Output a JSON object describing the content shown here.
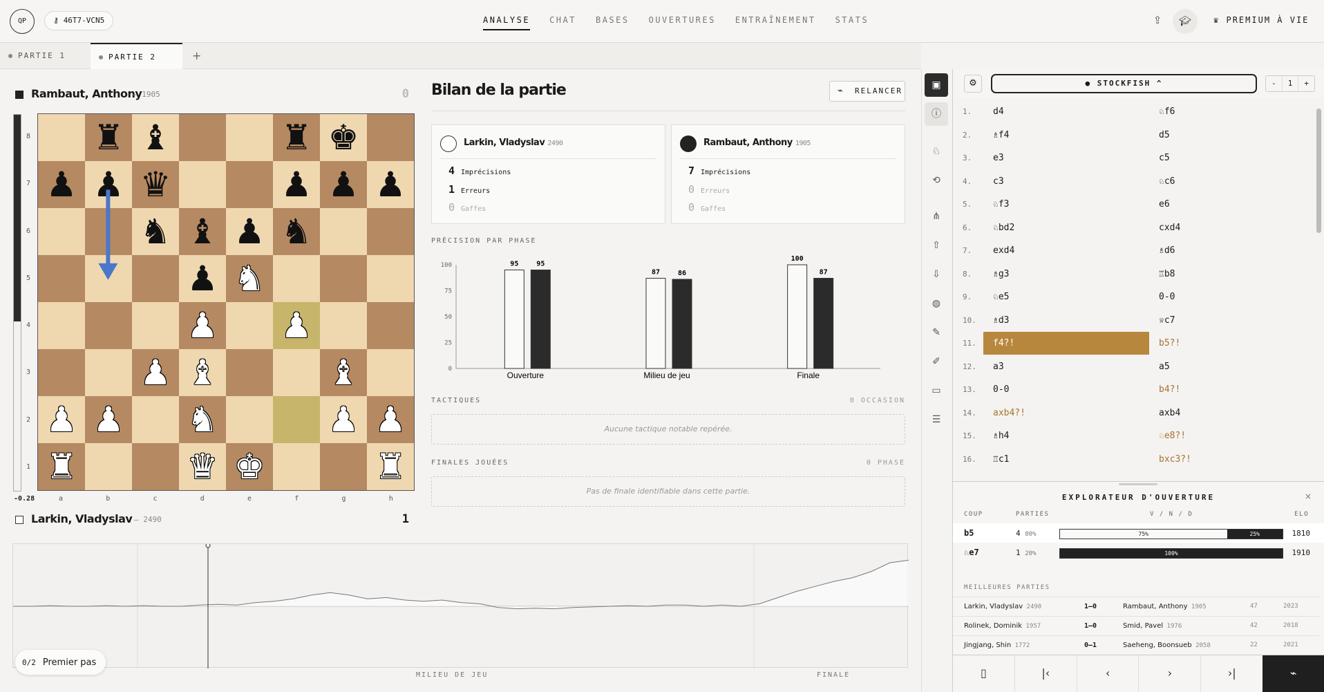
{
  "header": {
    "logo": "QP",
    "game_code": "46T7-VCN5",
    "nav": [
      "ANALYSE",
      "CHAT",
      "BASES",
      "OUVERTURES",
      "ENTRAÎNEMENT",
      "STATS"
    ],
    "active_nav": "ANALYSE",
    "premium": "PREMIUM À VIE",
    "icons": [
      "upload-icon",
      "graduation-cap-icon",
      "crown-icon"
    ]
  },
  "tabs": {
    "items": [
      "PARTIE 1",
      "PARTIE 2"
    ],
    "active": "PARTIE 2",
    "add": "+"
  },
  "top_player": {
    "name": "Rambaut, Anthony",
    "rating": "– 1905",
    "score": "0",
    "color": "black"
  },
  "bottom_player": {
    "name": "Larkin, Vladyslav",
    "rating": "– 2490",
    "score": "1",
    "color": "white"
  },
  "eval": {
    "text": "-0.28",
    "white_fraction": 0.45
  },
  "board": {
    "ranks": [
      "8",
      "7",
      "6",
      "5",
      "4",
      "3",
      "2",
      "1"
    ],
    "files": [
      "a",
      "b",
      "c",
      "d",
      "e",
      "f",
      "g",
      "h"
    ],
    "position": [
      [
        "",
        "r",
        "b",
        "",
        "",
        "r",
        "k",
        ""
      ],
      [
        "p",
        "p",
        "q",
        "",
        "",
        "p",
        "p",
        "p"
      ],
      [
        "",
        "",
        "n",
        "b",
        "p",
        "n",
        "",
        ""
      ],
      [
        "",
        "",
        "",
        "p",
        "N",
        "",
        "",
        ""
      ],
      [
        "",
        "",
        "",
        "P",
        "",
        "P",
        "",
        ""
      ],
      [
        "",
        "",
        "P",
        "B",
        "",
        "",
        "B",
        ""
      ],
      [
        "P",
        "P",
        "",
        "N",
        "",
        "",
        "P",
        "P"
      ],
      [
        "R",
        "",
        "",
        "Q",
        "K",
        "",
        "",
        "R"
      ]
    ],
    "last_move": [
      "f2",
      "f4"
    ],
    "arrow": {
      "from": "b7",
      "to": "b5",
      "color": "#4a77c9"
    }
  },
  "eval_graph": {
    "phase_labels": [
      "MILIEU DE JEU",
      "FINALE"
    ],
    "values": [
      0.0,
      0.0,
      0.05,
      0.0,
      0.0,
      0.05,
      0.0,
      0.05,
      0.0,
      0.0,
      0.1,
      0.15,
      0.1,
      0.3,
      0.4,
      0.6,
      0.9,
      1.1,
      0.9,
      0.6,
      0.7,
      0.5,
      0.4,
      0.5,
      0.3,
      0.2,
      -0.1,
      -0.2,
      -0.15,
      -0.2,
      -0.1,
      -0.05,
      0.0,
      0.05,
      0.0,
      0.1,
      0.1,
      0.0,
      0.1,
      0.0,
      0.2,
      0.7,
      1.2,
      1.6,
      2.0,
      2.3,
      2.8,
      3.5,
      3.7
    ]
  },
  "first_steps": {
    "count": "0/2",
    "label": "Premier pas"
  },
  "summary": {
    "title": "Bilan de la partie",
    "relaunch": "RELANCER",
    "white": {
      "name": "Larkin, Vladyslav",
      "rating": "2490",
      "inaccuracies": "4",
      "inaccuracies_label": "Imprécisions",
      "mistakes": "1",
      "mistakes_label": "Erreurs",
      "blunders": "0",
      "blunders_label": "Gaffes"
    },
    "black": {
      "name": "Rambaut, Anthony",
      "rating": "1905",
      "inaccuracies": "7",
      "inaccuracies_label": "Imprécisions",
      "mistakes": "0",
      "mistakes_label": "Erreurs",
      "blunders": "0",
      "blunders_label": "Gaffes"
    },
    "precision_label": "PRÉCISION PAR PHASE",
    "tactics_label": "TACTIQUES",
    "tactics_count": "0 OCCASION",
    "tactics_empty": "Aucune tactique notable repérée.",
    "endgames_label": "FINALES JOUÉES",
    "endgames_count": "0 PHASE",
    "endgames_empty": "Pas de finale identifiable dans cette partie."
  },
  "chart_data": {
    "type": "bar",
    "title": "",
    "categories": [
      "Ouverture",
      "Milieu de jeu",
      "Finale"
    ],
    "series": [
      {
        "name": "",
        "values": [
          95,
          87,
          100
        ],
        "color": "#fafaf9"
      },
      {
        "name": "",
        "values": [
          95,
          86,
          87
        ],
        "color": "#2b2b2b"
      }
    ],
    "yticks": [
      0,
      25,
      50,
      75,
      100
    ],
    "ylim": [
      0,
      100
    ],
    "grid": false
  },
  "engine": {
    "name": "● STOCKFISH ^",
    "lines": "1",
    "minus": "-",
    "plus": "+"
  },
  "moves": [
    {
      "n": "1.",
      "w": "d4",
      "b": "♘f6"
    },
    {
      "n": "2.",
      "w": "♗f4",
      "b": "d5"
    },
    {
      "n": "3.",
      "w": "e3",
      "b": "c5"
    },
    {
      "n": "4.",
      "w": "c3",
      "b": "♘c6"
    },
    {
      "n": "5.",
      "w": "♘f3",
      "b": "e6"
    },
    {
      "n": "6.",
      "w": "♘bd2",
      "b": "cxd4"
    },
    {
      "n": "7.",
      "w": "exd4",
      "b": "♗d6"
    },
    {
      "n": "8.",
      "w": "♗g3",
      "b": "♖b8"
    },
    {
      "n": "9.",
      "w": "♘e5",
      "b": "0-0"
    },
    {
      "n": "10.",
      "w": "♗d3",
      "b": "♕c7"
    },
    {
      "n": "11.",
      "w": "f4?!",
      "b": "b5?!"
    },
    {
      "n": "12.",
      "w": "a3",
      "b": "a5"
    },
    {
      "n": "13.",
      "w": "0-0",
      "b": "b4?!"
    },
    {
      "n": "14.",
      "w": "axb4?!",
      "b": "axb4"
    },
    {
      "n": "15.",
      "w": "♗h4",
      "b": "♘e8?!"
    },
    {
      "n": "16.",
      "w": "♖c1",
      "b": "bxc3?!"
    }
  ],
  "explorer": {
    "title": "EXPLORATEUR D'OUVERTURE",
    "close": "×",
    "headers": [
      "COUP",
      "PARTIES",
      "V / N / D",
      "ELO"
    ],
    "rows": [
      {
        "move": "b5",
        "games": "4",
        "pct": "80%",
        "white": "75%",
        "black": "25%",
        "white_frac": 0.75,
        "elo": "1810"
      },
      {
        "move": "♘e7",
        "games": "1",
        "pct": "20%",
        "white": "",
        "black": "100%",
        "white_frac": 0.0,
        "elo": "1910"
      }
    ],
    "best_title": "MEILLEURES PARTIES",
    "best_games": [
      {
        "white": "Larkin, Vladyslav",
        "welo": "2490",
        "result": "1–0",
        "black": "Rambaut, Anthony",
        "belo": "1905",
        "moves": "47",
        "year": "2023"
      },
      {
        "white": "Rolinek, Dominik",
        "welo": "1957",
        "result": "1–0",
        "black": "Smid, Pavel",
        "belo": "1976",
        "moves": "42",
        "year": "2018"
      },
      {
        "white": "Jingjang, Shin",
        "welo": "1772",
        "result": "0–1",
        "black": "Saeheng, Boonsueb",
        "belo": "2058",
        "moves": "22",
        "year": "2021"
      }
    ]
  },
  "bottom_nav": {
    "icons": [
      "book-icon",
      "first-move-icon",
      "prev-move-icon",
      "next-move-icon",
      "last-move-icon",
      "chart-icon"
    ],
    "glyphs": [
      "▯",
      "|‹",
      "‹",
      "›",
      "›|",
      "⌁"
    ]
  }
}
